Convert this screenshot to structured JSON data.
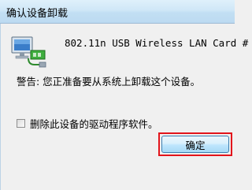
{
  "window": {
    "title": "确认设备卸载"
  },
  "device": {
    "name": "802.11n USB Wireless LAN Card #",
    "icon": "network-adapter-icon"
  },
  "message": {
    "warning": "警告: 您正准备要从系统上卸载这个设备。"
  },
  "options": {
    "delete_driver_label": "删除此设备的驱动程序软件。",
    "delete_driver_checked": false
  },
  "buttons": {
    "ok_label": "确定"
  },
  "colors": {
    "highlight": "#e2141b",
    "button_border": "#3c7fb1",
    "title_gradient_top": "#dff0fb",
    "dialog_bg": "#f0f0f0"
  }
}
